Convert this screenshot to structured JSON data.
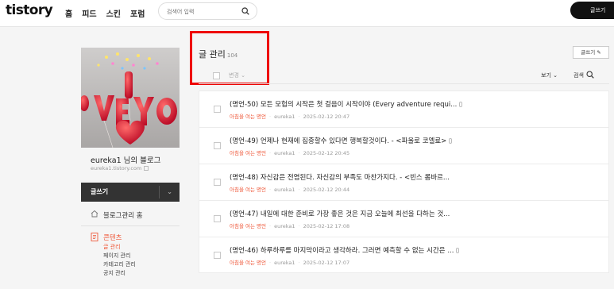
{
  "header": {
    "logo": "tistory",
    "nav": [
      "홈",
      "피드",
      "스킨",
      "포럼"
    ],
    "search_placeholder": "검색어 입력",
    "write_label": "글쓰기"
  },
  "sidebar": {
    "blog_name": "eureka1 님의 블로그",
    "blog_url": "eureka1.tistory.com",
    "write_label": "글쓰기",
    "home_label": "블로그관리 홈",
    "contents_label": "콘텐츠",
    "sub_items": [
      {
        "label": "글 관리",
        "active": true
      },
      {
        "label": "페이지 관리",
        "active": false
      },
      {
        "label": "카테고리 관리",
        "active": false
      },
      {
        "label": "공지 관리",
        "active": false
      }
    ]
  },
  "main": {
    "title": "글 관리",
    "count": "104",
    "write_button": "글쓰기",
    "change_label": "변경",
    "view_label": "보기",
    "search_label": "검색",
    "posts": [
      {
        "title": "(명언-50) 모든 모험의 시작은 첫 걸음이 시작이야 (Every adventure requi...",
        "category": "아침을 여는 명언",
        "author": "eureka1",
        "date": "2025-02-12 20:47"
      },
      {
        "title": "(명언-49) 언제나 현재에 집중할수 있다면 행복할것이다. - <파울로 코엘료>",
        "category": "아침을 여는 명언",
        "author": "eureka1",
        "date": "2025-02-12 20:45"
      },
      {
        "title": "(명언-48) 자신감은 전염된다. 자신감의 부족도 마찬가지다. - <빈스 롬바르...",
        "category": "아침을 여는 명언",
        "author": "eureka1",
        "date": "2025-02-12 20:44"
      },
      {
        "title": "(명언-47) 내일에 대한 준비로 가장 좋은 것은 지금 오늘에 최선을 다하는 것...",
        "category": "아침을 여는 명언",
        "author": "eureka1",
        "date": "2025-02-12 17:08"
      },
      {
        "title": "(명언-46) 하루하루를 마지막이라고 생각하라. 그러면 예측할 수 없는 시간은 ...",
        "category": "아침을 여는 명언",
        "author": "eureka1",
        "date": "2025-02-12 17:07"
      }
    ]
  }
}
